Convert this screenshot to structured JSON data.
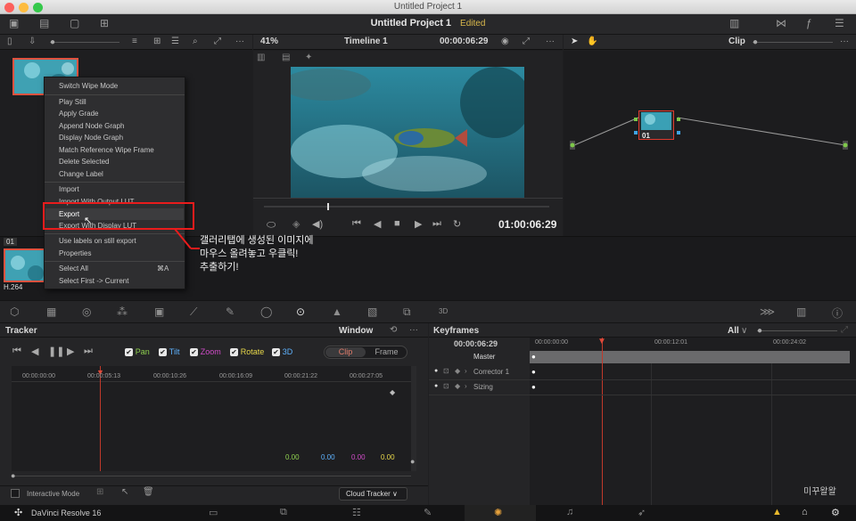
{
  "window_title": "Untitled Project 1",
  "project": {
    "title": "Untitled Project 1",
    "status": "Edited"
  },
  "viewer": {
    "zoom": "41%",
    "timeline": "Timeline 1",
    "timecode": "00:00:06:29",
    "big_timecode": "01:00:06:29"
  },
  "node_editor": {
    "mode": "Clip",
    "node_label": "01"
  },
  "clip": {
    "label": "01",
    "codec": "H.264"
  },
  "context_menu": {
    "items": [
      "Switch Wipe Mode",
      "Play Still",
      "Apply Grade",
      "Append Node Graph",
      "Display Node Graph",
      "Match Reference Wipe Frame",
      "Delete Selected",
      "Change Label",
      "Import",
      "Import With Output LUT",
      "Export",
      "Export With Display LUT",
      "Use labels on still export",
      "Properties",
      "Select All",
      "Select First -> Current"
    ],
    "select_all_shortcut": "⌘A"
  },
  "annotation": {
    "line1": "갤러리탭에 생성된 이미지에",
    "line2": "마우스 올려놓고 우클릭!",
    "line3": "추출하기!"
  },
  "tracker": {
    "title": "Tracker",
    "window_label": "Window",
    "checks": [
      "Pan",
      "Tilt",
      "Zoom",
      "Rotate",
      "3D"
    ],
    "check_colors": [
      "#8fd14f",
      "#5fb3ff",
      "#d04cc8",
      "#e8d84a",
      "#5fb3ff"
    ],
    "toggle": [
      "Clip",
      "Frame"
    ],
    "timecodes": [
      "00:00:00:00",
      "00:00:05:13",
      "00:00:10:26",
      "00:00:16:09",
      "00:00:21:22",
      "00:00:27:05"
    ],
    "values": [
      "0.00",
      "0.00",
      "0.00",
      "0.00"
    ],
    "interactive_mode": "Interactive Mode",
    "cloud_tracker": "Cloud Tracker"
  },
  "keyframes": {
    "title": "Keyframes",
    "filter": "All",
    "timecode": "00:00:06:29",
    "ruler": [
      "00:00:00:00",
      "00:00:12:01",
      "00:00:24:02"
    ],
    "tracks": [
      "Master",
      "Corrector 1",
      "Sizing"
    ]
  },
  "watermark": "미꾸왈왈",
  "app_name": "DaVinci Resolve 16"
}
